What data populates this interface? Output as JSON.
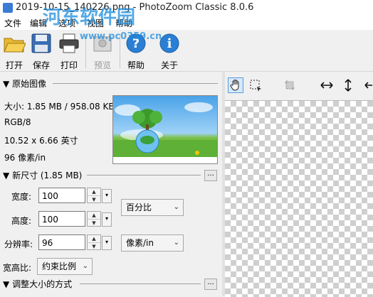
{
  "window": {
    "title": "2019-10-15_140226.png - PhotoZoom Classic 8.0.6"
  },
  "watermark": {
    "main": "河东软件园",
    "url": "www.pc0359.cn"
  },
  "menu": {
    "items": [
      "文件",
      "编辑",
      "选项",
      "视图",
      "帮助"
    ]
  },
  "toolbar": {
    "open": "打开",
    "save": "保存",
    "print": "打印",
    "preview": "预览",
    "help": "帮助",
    "about": "关于"
  },
  "original": {
    "header": "原始图像",
    "size": "大小: 1.85 MB / 958.08 KB",
    "mode": "RGB/8",
    "dimensions": "10.52 x 6.66 英寸",
    "resolution": "96 像素/in"
  },
  "new_size": {
    "header": "新尺寸 (1.85 MB)",
    "width_label": "宽度:",
    "width_value": "100",
    "height_label": "高度:",
    "height_value": "100",
    "unit": "百分比",
    "res_label": "分辨率:",
    "res_value": "96",
    "res_unit": "像素/in",
    "aspect_label": "宽高比:",
    "aspect_value": "约束比例",
    "ellipsis": "..."
  },
  "resize_method": {
    "header": "调整大小的方式",
    "ellipsis": "..."
  },
  "colors": {
    "accent": "#1e8cdc",
    "active_tool": "#d6e8fa"
  }
}
